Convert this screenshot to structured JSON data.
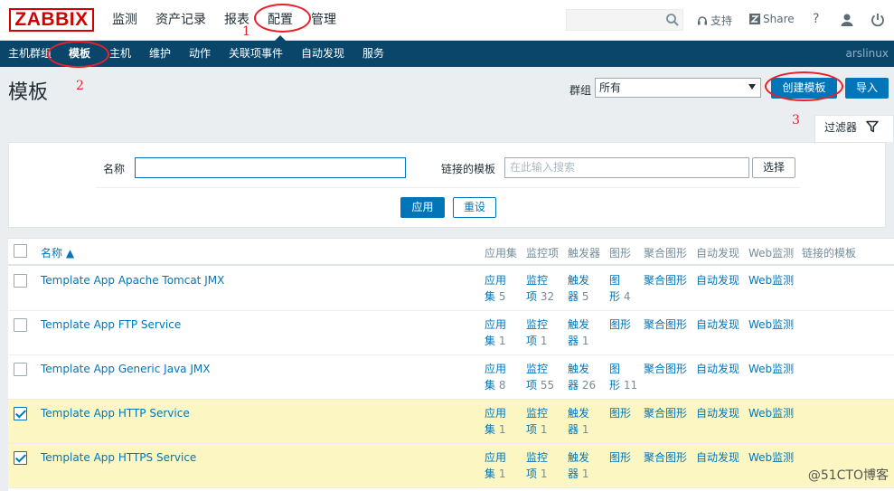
{
  "header": {
    "logo": "ZABBIX",
    "nav": [
      "监测",
      "资产记录",
      "报表",
      "配置",
      "管理"
    ],
    "active_nav": "配置",
    "support": "支持",
    "share": "Share",
    "help": "?"
  },
  "subnav": {
    "items": [
      "主机群组",
      "模板",
      "主机",
      "维护",
      "动作",
      "关联项事件",
      "自动发现",
      "服务"
    ],
    "active": "模板",
    "user": "arslinux"
  },
  "page": {
    "title": "模板",
    "group_label": "群组",
    "group_value": "所有",
    "create_button": "创建模板",
    "import_button": "导入"
  },
  "filter": {
    "tab_label": "过滤器",
    "name_label": "名称",
    "name_value": "",
    "linked_label": "链接的模板",
    "linked_placeholder": "在此输入搜索",
    "select_button": "选择",
    "apply_button": "应用",
    "reset_button": "重设"
  },
  "table": {
    "columns": [
      "名称 ▲",
      "应用集",
      "监控项",
      "触发器",
      "图形",
      "聚合图形",
      "自动发现",
      "Web监测",
      "链接的模板"
    ],
    "rows": [
      {
        "name": "Template App Apache Tomcat JMX",
        "checked": false,
        "selected": false,
        "apps_a": "应用",
        "apps_b": "集",
        "apps_n": "5",
        "items_a": "监控",
        "items_b": "项",
        "items_n": "32",
        "triggers_a": "触发",
        "triggers_b": "器",
        "triggers_n": "5",
        "graphs_a": "图",
        "graphs_b": "形",
        "graphs_n": "4",
        "screens": "聚合图形",
        "discovery": "自动发现",
        "web": "Web监测"
      },
      {
        "name": "Template App FTP Service",
        "checked": false,
        "selected": false,
        "apps_a": "应用",
        "apps_b": "集",
        "apps_n": "1",
        "items_a": "监控",
        "items_b": "项",
        "items_n": "1",
        "triggers_a": "触发",
        "triggers_b": "器",
        "triggers_n": "1",
        "graphs_a": "图形",
        "graphs_b": "",
        "graphs_n": "",
        "screens": "聚合图形",
        "discovery": "自动发现",
        "web": "Web监测"
      },
      {
        "name": "Template App Generic Java JMX",
        "checked": false,
        "selected": false,
        "apps_a": "应用",
        "apps_b": "集",
        "apps_n": "8",
        "items_a": "监控",
        "items_b": "项",
        "items_n": "55",
        "triggers_a": "触发",
        "triggers_b": "器",
        "triggers_n": "26",
        "graphs_a": "图",
        "graphs_b": "形",
        "graphs_n": "11",
        "screens": "聚合图形",
        "discovery": "自动发现",
        "web": "Web监测"
      },
      {
        "name": "Template App HTTP Service",
        "checked": true,
        "selected": true,
        "apps_a": "应用",
        "apps_b": "集",
        "apps_n": "1",
        "items_a": "监控",
        "items_b": "项",
        "items_n": "1",
        "triggers_a": "触发",
        "triggers_b": "器",
        "triggers_n": "1",
        "graphs_a": "图形",
        "graphs_b": "",
        "graphs_n": "",
        "screens": "聚合图形",
        "discovery": "自动发现",
        "web": "Web监测"
      },
      {
        "name": "Template App HTTPS Service",
        "checked": true,
        "selected": true,
        "apps_a": "应用",
        "apps_b": "集",
        "apps_n": "1",
        "items_a": "监控",
        "items_b": "项",
        "items_n": "1",
        "triggers_a": "触发",
        "triggers_b": "器",
        "triggers_n": "1",
        "graphs_a": "图形",
        "graphs_b": "",
        "graphs_n": "",
        "screens": "聚合图形",
        "discovery": "自动发现",
        "web": "Web监测"
      }
    ]
  },
  "annotations": [
    "1",
    "2",
    "3"
  ],
  "watermark": "@51CTO博客",
  "colors": {
    "accent": "#0275b8",
    "navbar": "#0a466a",
    "selected_row": "#fcf7c2",
    "annotation": "#e8202a",
    "logo": "#d40000"
  }
}
